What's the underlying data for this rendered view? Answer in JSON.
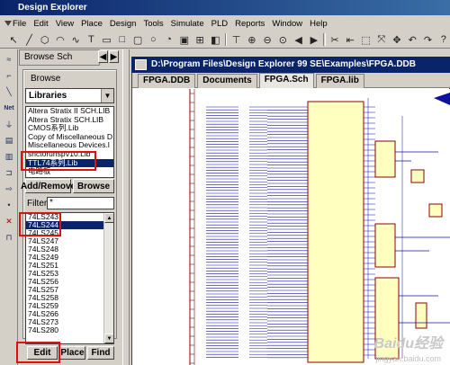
{
  "app": {
    "title": "Design Explorer"
  },
  "menu": [
    "File",
    "Edit",
    "View",
    "Place",
    "Design",
    "Tools",
    "Simulate",
    "PLD",
    "Reports",
    "Window",
    "Help"
  ],
  "panel": {
    "tab_label": "Browse Sch",
    "group_label": "Browse",
    "combo_value": "Libraries",
    "libraries": [
      "Altera Stratix II SCH.LIB",
      "Altera Stratix SCH.LIB",
      "CMOS系列.Lib",
      "Copy of Miscellaneous D",
      "Miscellaneous Devices.l",
      "shctorunsp\\/10.Lib",
      "TTL74系列.Lib",
      "电路板"
    ],
    "selected_library": "TTL74系列.Lib",
    "add_remove_label": "Add/Remove",
    "browse_label": "Browse",
    "filter_label": "Filter",
    "filter_value": "*",
    "components": [
      "74LS243",
      "74LS244",
      "74LS245",
      "74LS247",
      "74LS248",
      "74LS249",
      "74LS251",
      "74LS253",
      "74LS256",
      "74LS257",
      "74LS258",
      "74LS259",
      "74LS266",
      "74LS273",
      "74LS280"
    ],
    "selected_component": "74LS244",
    "edit_label": "Edit",
    "place_label": "Place",
    "find_label": "Find"
  },
  "document": {
    "title": "D:\\Program Files\\Design Explorer 99 SE\\Examples\\FPGA.DDB",
    "tabs": [
      "FPGA.DDB",
      "Documents",
      "FPGA.Sch",
      "FPGA.lib"
    ],
    "active_tab": "FPGA.Sch"
  },
  "watermark": {
    "text": "Baidu经验",
    "sub": "jingyan.baidu.com"
  },
  "colors": {
    "title_bar": "#0a246a",
    "selection": "#0a246a",
    "highlight_box": "#e01010",
    "wire": "#1010a0",
    "component_fill": "#ffffc0",
    "sheet_border": "#8b0000"
  }
}
